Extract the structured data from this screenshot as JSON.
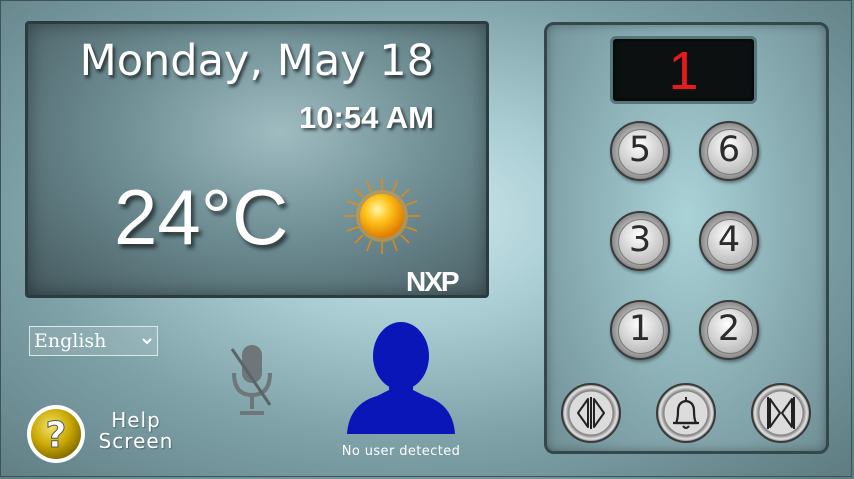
{
  "info": {
    "date": "Monday, May 18",
    "time": "10:54 AM",
    "temperature": "24°C",
    "weather_icon": "sun-icon",
    "logo_text": "NXP"
  },
  "language": {
    "selected": "English"
  },
  "voice": {
    "mic_state": "muted",
    "icon": "mic-off-icon"
  },
  "user": {
    "status": "No user detected",
    "icon": "user-silhouette-icon"
  },
  "help": {
    "label_line1": "Help",
    "label_line2": "Screen",
    "icon": "question-mark-icon"
  },
  "elevator": {
    "current_floor": "1",
    "floor_buttons": [
      "5",
      "6",
      "3",
      "4",
      "1",
      "2"
    ],
    "controls": [
      "door-open-icon",
      "alarm-bell-icon",
      "door-close-icon"
    ]
  },
  "colors": {
    "floor_digit": "#e8191a",
    "avatar": "#0a16b8",
    "help_button": "#c9a800"
  }
}
